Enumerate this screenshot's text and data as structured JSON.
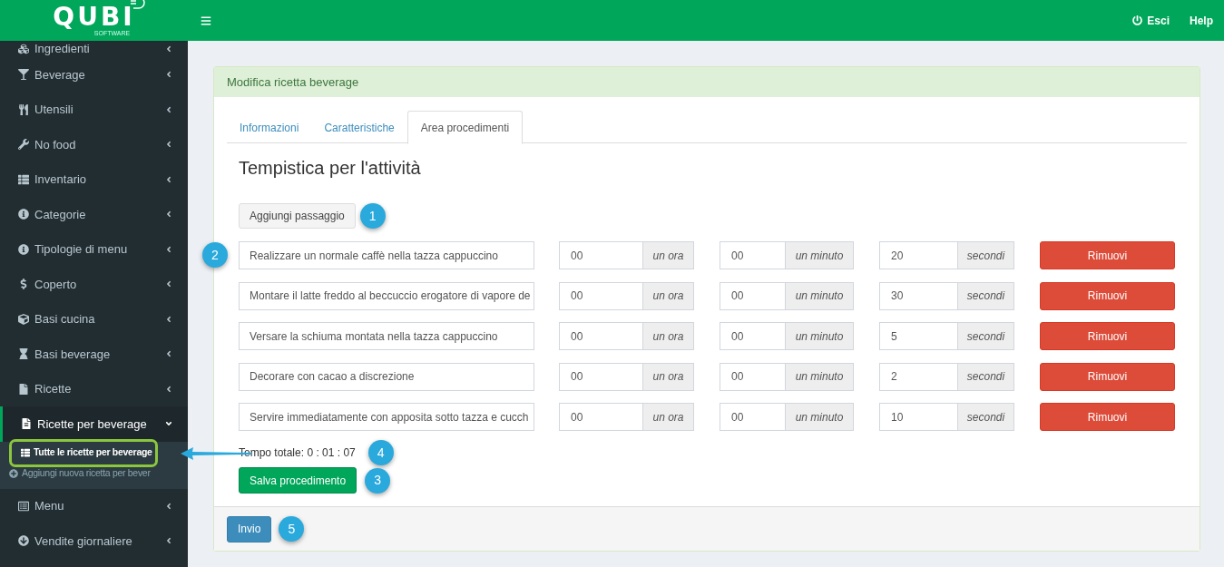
{
  "header": {
    "logo": "QUBI",
    "logo_sub": "SOFTWARE",
    "actions": [
      "Esci",
      "Help"
    ]
  },
  "sidebar": {
    "items": [
      {
        "label": "Ingredienti",
        "expanded": false
      },
      {
        "label": "Beverage",
        "expanded": false
      },
      {
        "label": "Utensili",
        "expanded": false
      },
      {
        "label": "No food",
        "expanded": false
      },
      {
        "label": "Inventario",
        "expanded": false
      },
      {
        "label": "Categorie",
        "expanded": false
      },
      {
        "label": "Tipologie di menu",
        "expanded": false
      },
      {
        "label": "Coperto",
        "expanded": false
      },
      {
        "label": "Basi cucina",
        "expanded": false
      },
      {
        "label": "Basi beverage",
        "expanded": false
      },
      {
        "label": "Ricette",
        "expanded": false
      },
      {
        "label": "Ricette per beverage",
        "expanded": true,
        "children": [
          {
            "label": "Tutte le ricette per beverage",
            "selected": true,
            "annotated": true
          },
          {
            "label": "Aggiungi nuova ricetta per bever",
            "selected": false,
            "annotated": false
          }
        ]
      },
      {
        "label": "Menu",
        "expanded": false
      },
      {
        "label": "Vendite giornaliere",
        "expanded": false
      }
    ]
  },
  "panel": {
    "title": "Modifica ricetta beverage",
    "tabs": [
      {
        "label": "Informazioni",
        "selected": false
      },
      {
        "label": "Caratteristiche",
        "selected": false
      },
      {
        "label": "Area procedimenti",
        "selected": true
      }
    ],
    "heading": "Tempistica per l'attività",
    "add_step": {
      "label": "Aggiungi passaggio",
      "callout": "1"
    },
    "steps": [
      {
        "description": "Realizzare un normale caffè nella tazza cappuccino",
        "hours": "00",
        "hours_unit": "un ora",
        "minutes": "00",
        "minutes_unit": "un minuto",
        "seconds": "20",
        "seconds_unit": "secondi",
        "remove": "Rimuovi",
        "callout": "2"
      },
      {
        "description": "Montare il latte freddo al beccuccio erogatore di vapore de",
        "hours": "00",
        "hours_unit": "un ora",
        "minutes": "00",
        "minutes_unit": "un minuto",
        "seconds": "30",
        "seconds_unit": "secondi",
        "remove": "Rimuovi"
      },
      {
        "description": "Versare  la schiuma montata nella tazza cappuccino",
        "hours": "00",
        "hours_unit": "un ora",
        "minutes": "00",
        "minutes_unit": "un minuto",
        "seconds": "5",
        "seconds_unit": "secondi",
        "remove": "Rimuovi"
      },
      {
        "description": "Decorare con cacao a discrezione",
        "hours": "00",
        "hours_unit": "un ora",
        "minutes": "00",
        "minutes_unit": "un minuto",
        "seconds": "2",
        "seconds_unit": "secondi",
        "remove": "Rimuovi"
      },
      {
        "description": "Servire immediatamente con  apposita sotto tazza e cucch",
        "hours": "00",
        "hours_unit": "un ora",
        "minutes": "00",
        "minutes_unit": "un minuto",
        "seconds": "10",
        "seconds_unit": "secondi",
        "remove": "Rimuovi"
      }
    ],
    "total": {
      "text": "Tempo totale: 0 : 01 : 07",
      "callout": "4"
    },
    "save": {
      "label": "Salva procedimento",
      "callout": "3"
    },
    "submit": {
      "label": "Invio",
      "callout": "5"
    }
  }
}
